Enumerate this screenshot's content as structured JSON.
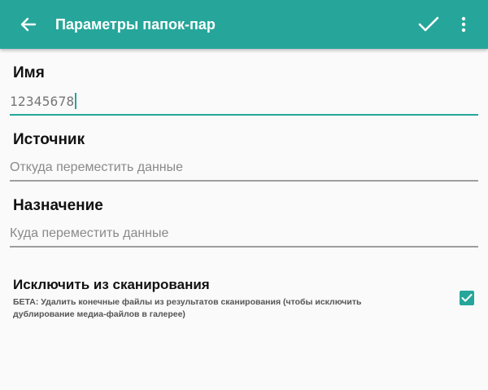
{
  "appbar": {
    "title": "Параметры папок-пар",
    "back_icon": "arrow-back-icon",
    "confirm_icon": "check-icon",
    "menu_icon": "more-vert-icon",
    "color": "#26a69a"
  },
  "form": {
    "name": {
      "label": "Имя",
      "value": "12345678"
    },
    "source": {
      "label": "Источник",
      "placeholder": "Откуда переместить данные"
    },
    "destination": {
      "label": "Назначение",
      "placeholder": "Куда переместить данные"
    },
    "exclude": {
      "title": "Исключить из сканирования",
      "description": "БЕТА: Удалить конечные файлы из результатов сканирования (чтобы исключить дублирование медиа-файлов в галерее)",
      "checked": true
    }
  },
  "colors": {
    "accent": "#26a69a",
    "background": "#fafafa",
    "underline_inactive": "#9e9e9e"
  }
}
